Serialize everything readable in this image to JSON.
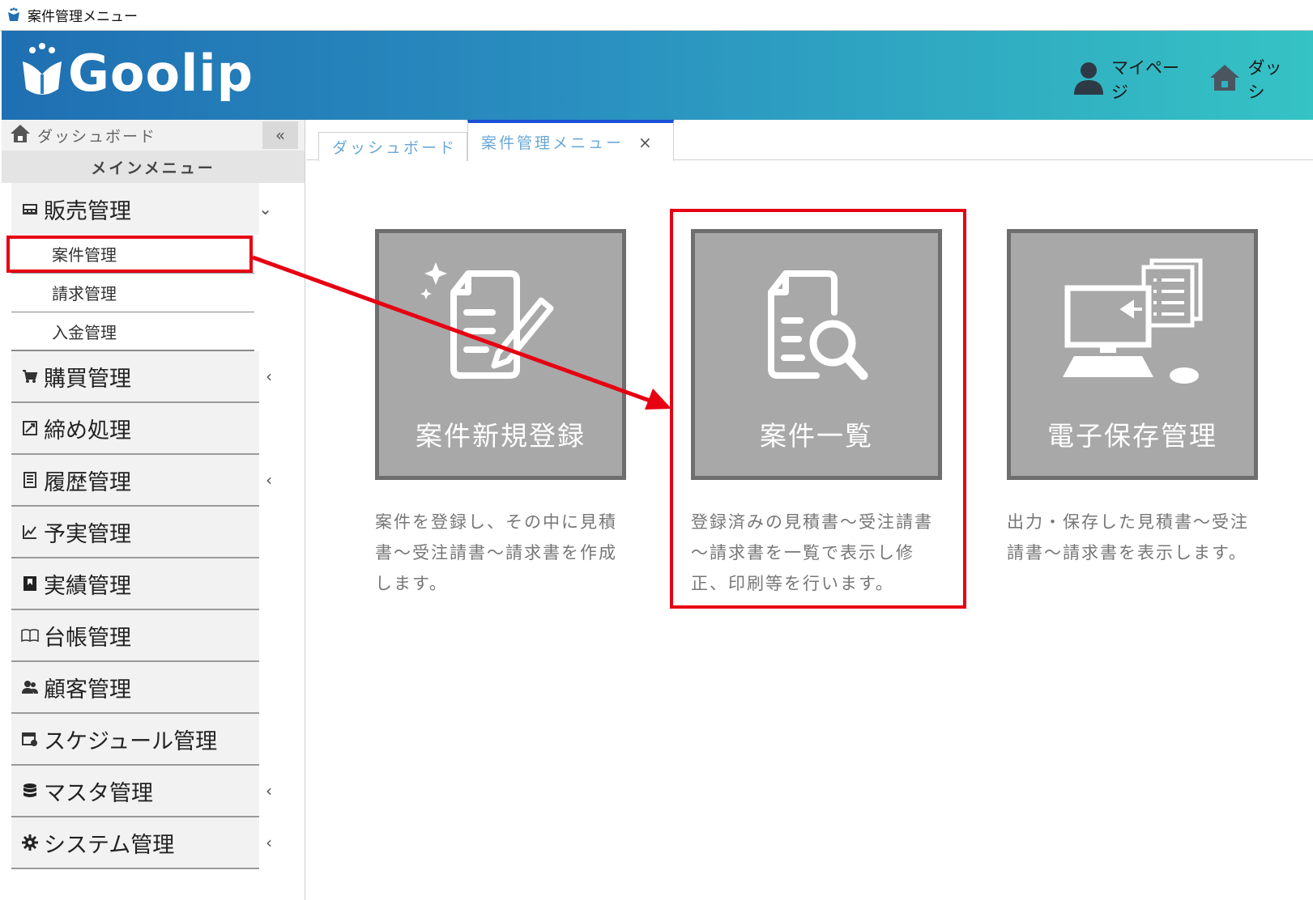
{
  "window": {
    "title": "案件管理メニュー"
  },
  "header": {
    "logo": "Goolip",
    "nav": [
      {
        "label": "マイページ",
        "icon": "user-icon"
      },
      {
        "label": "ダッシ",
        "icon": "home-icon"
      }
    ]
  },
  "sidebar": {
    "home_label": "ダッシュボード",
    "collapse_label": "«",
    "heading": "メインメニュー",
    "sales": {
      "label": "販売管理",
      "submenu": [
        "案件管理",
        "請求管理",
        "入金管理"
      ]
    },
    "items": [
      {
        "label": "購買管理",
        "icon": "cart-icon",
        "chevron": "‹"
      },
      {
        "label": "締め処理",
        "icon": "close-period-icon",
        "chevron": ""
      },
      {
        "label": "履歴管理",
        "icon": "history-icon",
        "chevron": "‹"
      },
      {
        "label": "予実管理",
        "icon": "chart-icon",
        "chevron": ""
      },
      {
        "label": "実績管理",
        "icon": "bookmark-icon",
        "chevron": ""
      },
      {
        "label": "台帳管理",
        "icon": "book-icon",
        "chevron": ""
      },
      {
        "label": "顧客管理",
        "icon": "customers-icon",
        "chevron": ""
      },
      {
        "label": "スケジュール管理",
        "icon": "calendar-icon",
        "chevron": ""
      },
      {
        "label": "マスタ管理",
        "icon": "database-icon",
        "chevron": "‹"
      },
      {
        "label": "システム管理",
        "icon": "gear-icon",
        "chevron": "‹"
      }
    ]
  },
  "tabs": [
    {
      "label": "ダッシュボード",
      "active": false
    },
    {
      "label": "案件管理メニュー",
      "active": true,
      "close": "×"
    }
  ],
  "cards": [
    {
      "title": "案件新規登録",
      "icon": "document-edit-icon",
      "desc": [
        "案件を登録し、その中に見積",
        "書～受注請書～請求書を作成",
        "します。"
      ]
    },
    {
      "title": "案件一覧",
      "icon": "document-search-icon",
      "desc": [
        "登録済みの見積書～受注請書",
        "～請求書を一覧で表示し修",
        "正、印刷等を行います。"
      ]
    },
    {
      "title": "電子保存管理",
      "icon": "computer-storage-icon",
      "desc": [
        "出力・保存した見積書～受注",
        "請書～請求書を表示します。"
      ]
    }
  ],
  "colors": {
    "header_start": "#1f6fb2",
    "header_end": "#35c3c4",
    "highlight": "#e60012",
    "card": "#a8a8a8"
  }
}
